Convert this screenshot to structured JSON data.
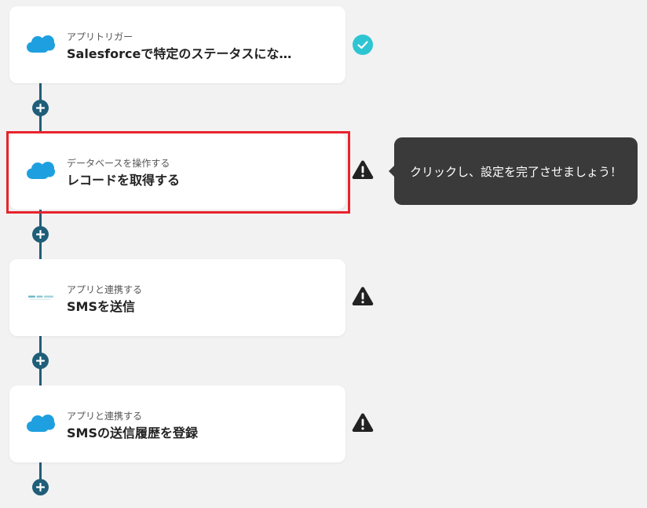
{
  "steps": [
    {
      "subtitle": "アプリトリガー",
      "title": "Salesforceで特定のステータスにな…",
      "icon": "salesforce-icon",
      "status": "complete"
    },
    {
      "subtitle": "データベースを操作する",
      "title": "レコードを取得する",
      "icon": "salesforce-icon",
      "status": "warning"
    },
    {
      "subtitle": "アプリと連携する",
      "title": "SMSを送信",
      "icon": "sms-service-logo-icon",
      "status": "warning"
    },
    {
      "subtitle": "アプリと連携する",
      "title": "SMSの送信履歴を登録",
      "icon": "salesforce-icon",
      "status": "warning"
    }
  ],
  "tooltip": {
    "text": "クリックし、設定を完了させましょう！"
  },
  "colors": {
    "background": "#f2f2f2",
    "card": "#ffffff",
    "connector": "#1f5e78",
    "check": "#2ec5d3",
    "warning": "#222222",
    "highlight": "#e8232c",
    "tooltip_bg": "#3a3a3a",
    "salesforce": "#1ea0e0"
  }
}
